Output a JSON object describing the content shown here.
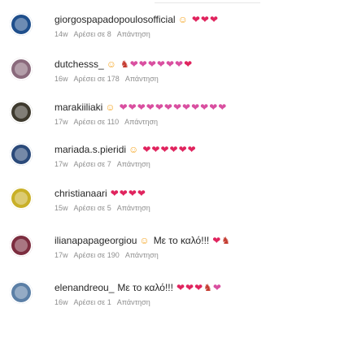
{
  "colors": {
    "text": "#262626",
    "meta": "#8e8e8e",
    "heart": "#e0245e"
  },
  "comments": [
    {
      "username": "giorgospapadopoulosofficial",
      "body": "",
      "mention_icon": "heart-eyes-emoji",
      "reactions": [
        "heart",
        "heart",
        "heart"
      ],
      "time": "14w",
      "likes": "Αρέσει σε 8",
      "reply": "Απάντηση",
      "avatar_color": "#1f4f8c"
    },
    {
      "username": "dutchesss_",
      "body": "",
      "mention_icon": "heart-eyes-emoji",
      "reactions": [
        "dancer",
        "sparkle",
        "sparkle",
        "sparkle",
        "sparkle",
        "sparkle",
        "sparkle",
        "heart"
      ],
      "time": "16w",
      "likes": "Αρέσει σε 178",
      "reply": "Απάντηση",
      "avatar_color": "#8a6a7c"
    },
    {
      "username": "marakiiliaki",
      "body": "",
      "mention_icon": "heart-eyes-emoji",
      "reactions": [
        "sparkle",
        "sparkle",
        "sparkle",
        "sparkle",
        "sparkle",
        "sparkle",
        "sparkle",
        "sparkle",
        "sparkle",
        "sparkle",
        "sparkle",
        "sparkle"
      ],
      "time": "17w",
      "likes": "Αρέσει σε 110",
      "reply": "Απάντηση",
      "avatar_color": "#3e3a2e"
    },
    {
      "username": "mariada.s.pieridi",
      "body": "",
      "mention_icon": "heart-eyes-emoji",
      "reactions": [
        "heart",
        "heart",
        "heart",
        "heart",
        "heart",
        "heart"
      ],
      "time": "17w",
      "likes": "Αρέσει σε 7",
      "reply": "Απάντηση",
      "avatar_color": "#2b4a7a"
    },
    {
      "username": "christianaari",
      "body": "",
      "mention_icon": "",
      "reactions": [
        "heart",
        "heart",
        "heart",
        "heart"
      ],
      "time": "15w",
      "likes": "Αρέσει σε 5",
      "reply": "Απάντηση",
      "avatar_color": "#c9b027"
    },
    {
      "username": "ilianapapageorgiou",
      "body": "Με το καλό!!!",
      "mention_icon": "heart-eyes-emoji",
      "reactions": [
        "heart",
        "dancer"
      ],
      "time": "17w",
      "likes": "Αρέσει σε 190",
      "reply": "Απάντηση",
      "avatar_color": "#7c2d3f"
    },
    {
      "username": "elenandreou_",
      "body": "Με το καλό!!!",
      "mention_icon": "",
      "reactions": [
        "heart",
        "heart",
        "heart",
        "dancer",
        "sparkle"
      ],
      "time": "16w",
      "likes": "Αρέσει σε 1",
      "reply": "Απάντηση",
      "avatar_color": "#5b7fa6"
    }
  ]
}
